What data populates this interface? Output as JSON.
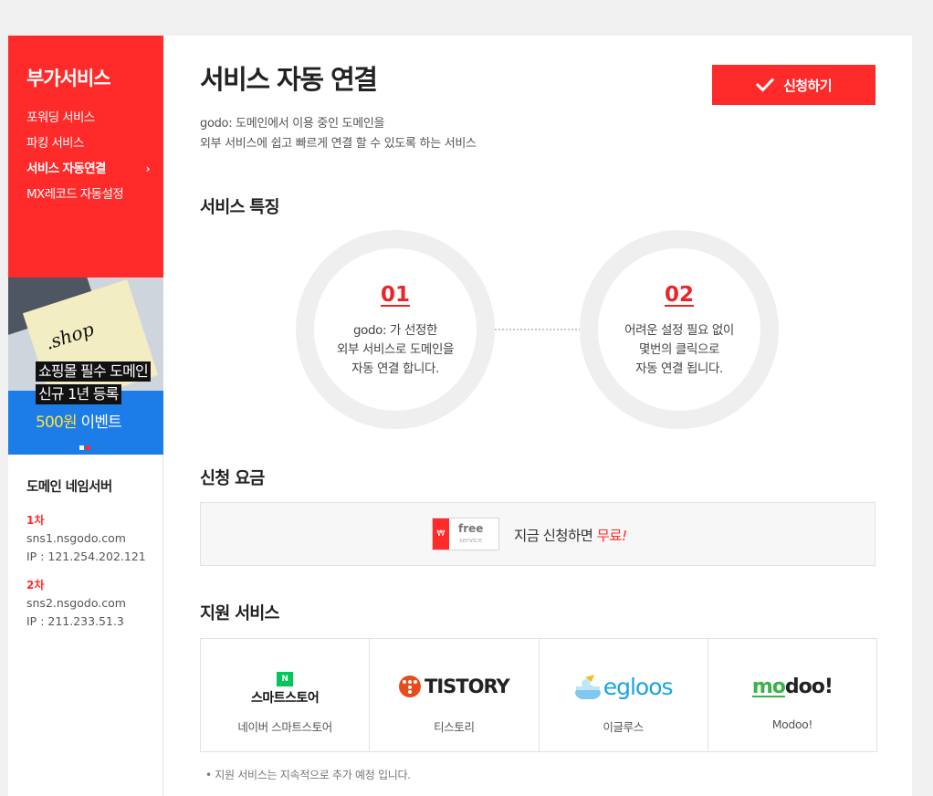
{
  "sidebar": {
    "title": "부가서비스",
    "items": [
      {
        "label": "포워딩 서비스",
        "active": false
      },
      {
        "label": "파킹 서비스",
        "active": false
      },
      {
        "label": "서비스 자동연결",
        "active": true,
        "chevron": "›"
      },
      {
        "label": "MX레코드 자동설정",
        "active": false
      }
    ],
    "banner": {
      "shop_text": ".shop",
      "line1": "쇼핑몰 필수 도메인",
      "line2": "신규 1년 등록",
      "price": "500원",
      "event": " 이벤트"
    },
    "nameserver": {
      "title": "도메인 네임서버",
      "primary": {
        "label": "1차",
        "host": "sns1.nsgodo.com",
        "ip": "IP : 121.254.202.121"
      },
      "secondary": {
        "label": "2차",
        "host": "sns2.nsgodo.com",
        "ip": "IP : 211.233.51.3"
      }
    }
  },
  "main": {
    "title": "서비스 자동 연결",
    "apply_label": "신청하기",
    "desc_line1": "godo: 도메인에서 이용 중인 도메인을",
    "desc_line2": "외부 서비스에 쉽고 빠르게 연결 할 수 있도록 하는 서비스",
    "features_title": "서비스 특징",
    "features": [
      {
        "num": "01",
        "line1": "godo: 가 선정한",
        "line2": "외부 서비스로 도메인을",
        "line3": "자동 연결 합니다."
      },
      {
        "num": "02",
        "line1": "어려운 설정 필요 없이",
        "line2": "몇번의 클릭으로",
        "line3": "자동 연결 됩니다."
      }
    ],
    "fee_title": "신청 요금",
    "fee": {
      "icon_tag": "₩",
      "icon_free": "free",
      "icon_service": "service",
      "text": "지금 신청하면 ",
      "free": "무료",
      "mark": "!"
    },
    "support_title": "지원 서비스",
    "services": [
      {
        "logo_text": "스마트스토어",
        "logo_badge": "N",
        "name": "네이버 스마트스토어"
      },
      {
        "logo_text": "TISTORY",
        "name": "티스토리"
      },
      {
        "logo_text": "egloos",
        "name": "이글루스"
      },
      {
        "logo_text_a": "mo",
        "logo_text_b": "doo!",
        "name": "Modoo!"
      }
    ],
    "note": "• 지원 서비스는 지속적으로 추가 예정 입니다."
  },
  "colors": {
    "brand_red": "#ff2a2a",
    "banner_blue": "#1c7ce8",
    "circle_gray": "#efefef"
  }
}
